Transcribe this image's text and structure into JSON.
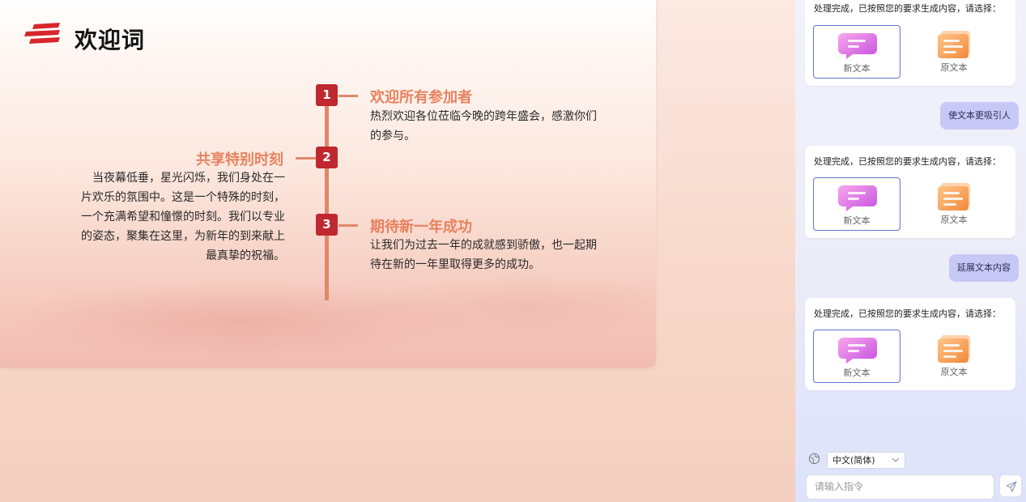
{
  "slide": {
    "title": "欢迎词",
    "items": [
      {
        "number": "1",
        "title": "欢迎所有参加者",
        "text": "热烈欢迎各位莅临今晚的跨年盛会，感激你们的参与。"
      },
      {
        "number": "2",
        "title": "共享特别时刻",
        "lines": [
          "当夜幕低垂，星光闪烁，我们身处在一",
          "片欢乐的氛围中。这是一个特殊的时刻，",
          "一个充满希望和憧憬的时刻。我们以专业",
          "的姿态，聚集在这里，为新年的到来献上",
          "最真挚的祝福。"
        ]
      },
      {
        "number": "3",
        "title": "期待新一年成功",
        "text": "让我们为过去一年的成就感到骄傲，也一起期待在新的一年里取得更多的成功。"
      }
    ]
  },
  "chat": {
    "cards": [
      {
        "text": "处理完成，已按照您的要求生成内容，请选择：",
        "option_new": "新文本",
        "option_original": "原文本"
      },
      {
        "text": "处理完成，已按照您的要求生成内容，请选择：",
        "option_new": "新文本",
        "option_original": "原文本"
      },
      {
        "text": "处理完成，已按照您的要求生成内容，请选择：",
        "option_new": "新文本",
        "option_original": "原文本"
      }
    ],
    "user_messages": [
      "使文本更吸引人",
      "延展文本内容"
    ],
    "language": "中文(简体)",
    "input_placeholder": "请输入指令"
  },
  "colors": {
    "badge": "#c0282f",
    "accent_title": "#e8825f",
    "timeline": "#e0886a",
    "selected_border": "#6a6fd2",
    "user_bubble": "#c7c8f6"
  },
  "icons": [
    "slide-logo-icon",
    "new-text-bubble-icon",
    "original-text-document-icon",
    "globe-icon",
    "chevron-down-icon",
    "send-icon"
  ]
}
